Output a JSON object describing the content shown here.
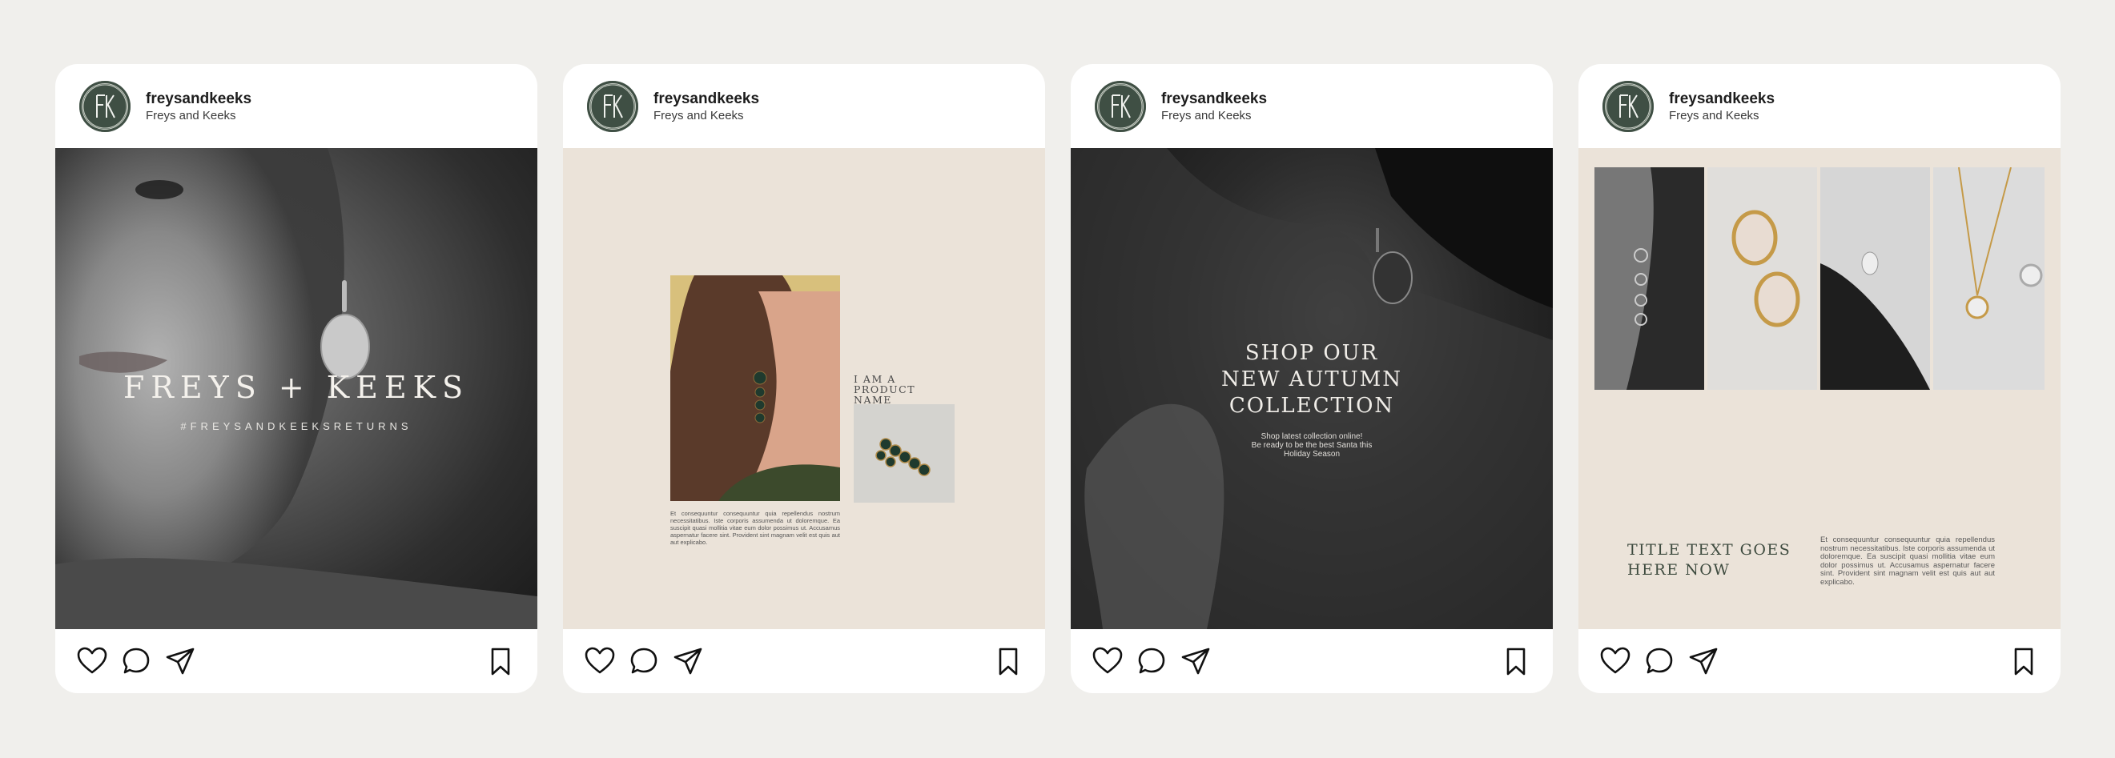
{
  "posts": [
    {
      "username": "freysandkeeks",
      "subname": "Freys and Keeks",
      "brand_title": "FREYS + KEEKS",
      "hashtag": "#FREYSANDKEEKSRETURNS"
    },
    {
      "username": "freysandkeeks",
      "subname": "Freys and Keeks",
      "product_name": "I AM A PRODUCT NAME",
      "description": "Et consequuntur consequuntur quia repellendus nostrum necessitatibus. Iste corporis assumenda ut doloremque. Ea suscipit quasi mollitia vitae eum dolor possimus ut. Accusamus aspernatur facere sint. Provident sint magnam velit est quis aut aut explicabo."
    },
    {
      "username": "freysandkeeks",
      "subname": "Freys and Keeks",
      "headline_lines": [
        "SHOP OUR",
        "NEW AUTUMN",
        "COLLECTION"
      ],
      "sub_lines": [
        "Shop latest collection online!",
        "Be ready to be the best Santa this",
        "Holiday Season"
      ]
    },
    {
      "username": "freysandkeeks",
      "subname": "Freys and Keeks",
      "title_lines": [
        "TITLE TEXT GOES",
        "HERE NOW"
      ],
      "description": "Et consequuntur consequuntur quia repellendus nostrum necessitatibus. Iste corporis assumenda ut doloremque. Ea suscipit quasi mollitia vitae eum dolor possimus ut. Accusamus aspernatur facere sint. Provident sint magnam velit est quis aut aut explicabo."
    }
  ],
  "avatar_monogram": "FK",
  "icons": [
    "heart-icon",
    "comment-icon",
    "send-icon",
    "bookmark-icon"
  ],
  "colors": {
    "background": "#f0efec",
    "card": "#ffffff",
    "avatar": "#3f4f44",
    "beige": "#ebe3d9",
    "ink": "#1d1d1d"
  }
}
